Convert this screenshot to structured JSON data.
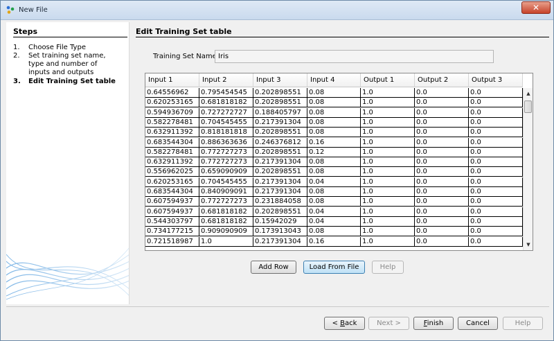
{
  "window": {
    "title": "New File",
    "close_symbol": "✕"
  },
  "steps": {
    "title": "Steps",
    "items": [
      {
        "num": "1.",
        "label": "Choose File Type"
      },
      {
        "num": "2.",
        "label": "Set training set name, type and number of inputs and outputs"
      },
      {
        "num": "3.",
        "label": "Edit Training Set table"
      }
    ]
  },
  "main": {
    "title": "Edit Training Set table",
    "training_set_name_label": "Training Set Name:",
    "training_set_name_value": "Iris"
  },
  "table": {
    "columns": [
      "Input 1",
      "Input 2",
      "Input 3",
      "Input 4",
      "Output 1",
      "Output 2",
      "Output 3"
    ],
    "rows": [
      [
        "0.64556962",
        "0.795454545",
        "0.202898551",
        "0.08",
        "1.0",
        "0.0",
        "0.0"
      ],
      [
        "0.620253165",
        "0.681818182",
        "0.202898551",
        "0.08",
        "1.0",
        "0.0",
        "0.0"
      ],
      [
        "0.594936709",
        "0.727272727",
        "0.188405797",
        "0.08",
        "1.0",
        "0.0",
        "0.0"
      ],
      [
        "0.582278481",
        "0.704545455",
        "0.217391304",
        "0.08",
        "1.0",
        "0.0",
        "0.0"
      ],
      [
        "0.632911392",
        "0.818181818",
        "0.202898551",
        "0.08",
        "1.0",
        "0.0",
        "0.0"
      ],
      [
        "0.683544304",
        "0.886363636",
        "0.246376812",
        "0.16",
        "1.0",
        "0.0",
        "0.0"
      ],
      [
        "0.582278481",
        "0.772727273",
        "0.202898551",
        "0.12",
        "1.0",
        "0.0",
        "0.0"
      ],
      [
        "0.632911392",
        "0.772727273",
        "0.217391304",
        "0.08",
        "1.0",
        "0.0",
        "0.0"
      ],
      [
        "0.556962025",
        "0.659090909",
        "0.202898551",
        "0.08",
        "1.0",
        "0.0",
        "0.0"
      ],
      [
        "0.620253165",
        "0.704545455",
        "0.217391304",
        "0.04",
        "1.0",
        "0.0",
        "0.0"
      ],
      [
        "0.683544304",
        "0.840909091",
        "0.217391304",
        "0.08",
        "1.0",
        "0.0",
        "0.0"
      ],
      [
        "0.607594937",
        "0.772727273",
        "0.231884058",
        "0.08",
        "1.0",
        "0.0",
        "0.0"
      ],
      [
        "0.607594937",
        "0.681818182",
        "0.202898551",
        "0.04",
        "1.0",
        "0.0",
        "0.0"
      ],
      [
        "0.544303797",
        "0.681818182",
        "0.15942029",
        "0.04",
        "1.0",
        "0.0",
        "0.0"
      ],
      [
        "0.734177215",
        "0.909090909",
        "0.173913043",
        "0.08",
        "1.0",
        "0.0",
        "0.0"
      ],
      [
        "0.721518987",
        "1.0",
        "0.217391304",
        "0.16",
        "1.0",
        "0.0",
        "0.0"
      ]
    ]
  },
  "buttons": {
    "add_row": "Add Row",
    "load_from_file": "Load From File",
    "help_table": "Help",
    "back_prefix": "< ",
    "back_key": "B",
    "back_rest": "ack",
    "next": "Next >",
    "finish_key": "F",
    "finish_rest": "inish",
    "cancel": "Cancel",
    "help": "Help"
  },
  "colors": {
    "title_bar": "#c9daee",
    "close_button": "#c7432a",
    "focus_button": "#bfe1f6"
  }
}
